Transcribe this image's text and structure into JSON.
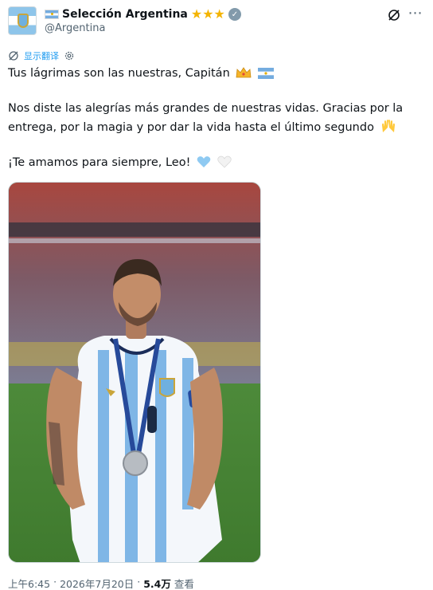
{
  "account": {
    "display_name": "Selección Argentina",
    "handle": "@Argentina",
    "stars": "★★★",
    "verified_mark": "✓",
    "more_glyph": "⋯"
  },
  "translate": {
    "label": "显示翻译"
  },
  "tweet": {
    "line1": "Tus lágrimas son las nuestras, Capitán",
    "line2": "Nos diste las alegrías más grandes de nuestras vidas. Gracias por la entrega, por la magia y por dar la vida hasta el último segundo",
    "line3": "¡Te amamos para siempre, Leo!"
  },
  "image": {
    "alt_icon": "photo-of-player-in-argentina-jersey"
  },
  "meta": {
    "time": "上午6:45",
    "separator": "·",
    "date": "2026年7月20日",
    "views_count": "5.4万",
    "views_label": "查看"
  },
  "colors": {
    "accent": "#1d9bf0",
    "text": "#0f1419",
    "secondary": "#536471",
    "star": "#f4b400",
    "argentina_blue": "#74acdf"
  }
}
